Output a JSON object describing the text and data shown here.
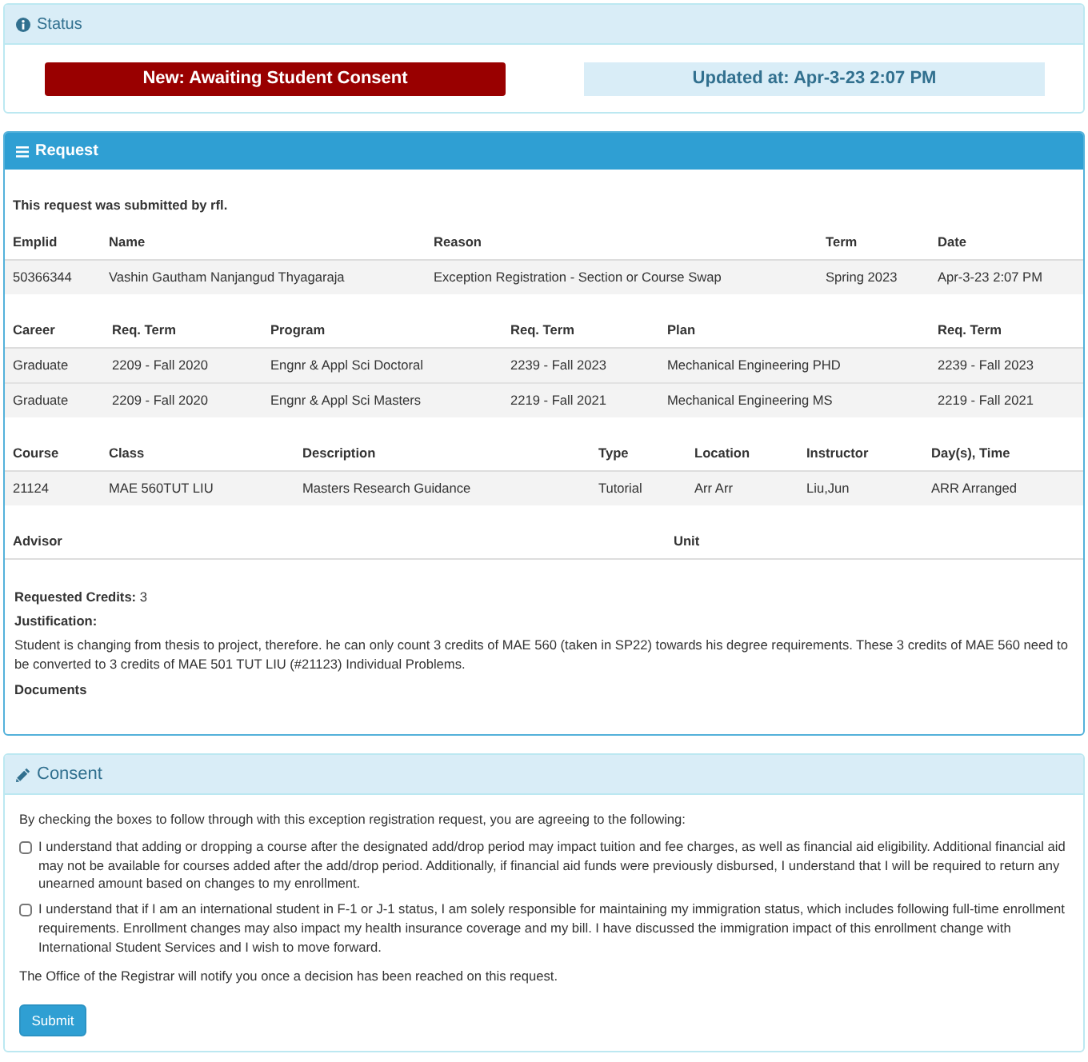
{
  "status": {
    "title": "Status",
    "state": "New: Awaiting Student Consent",
    "updated": "Updated at: Apr-3-23 2:07 PM"
  },
  "request": {
    "title": "Request",
    "submitted_by": "This request was submitted by rfl.",
    "tables": [
      {
        "columns": [
          "Emplid",
          "Name",
          "Reason",
          "Term",
          "Date"
        ],
        "rows": [
          [
            "50366344",
            "Vashin Gautham Nanjangud Thyagaraja",
            "Exception Registration - Section or Course Swap",
            "Spring 2023",
            "Apr-3-23 2:07 PM"
          ]
        ]
      },
      {
        "columns": [
          "Career",
          "Req. Term",
          "Program",
          "Req. Term",
          "Plan",
          "Req. Term"
        ],
        "rows": [
          [
            "Graduate",
            "2209 - Fall 2020",
            "Engnr & Appl Sci Doctoral",
            "2239 - Fall 2023",
            "Mechanical Engineering PHD",
            "2239 - Fall 2023"
          ],
          [
            "Graduate",
            "2209 - Fall 2020",
            "Engnr & Appl Sci Masters",
            "2219 - Fall 2021",
            "Mechanical Engineering MS",
            "2219 - Fall 2021"
          ]
        ]
      },
      {
        "columns": [
          "Course",
          "Class",
          "Description",
          "Type",
          "Location",
          "Instructor",
          "Day(s), Time"
        ],
        "rows": [
          [
            "21124",
            "MAE 560TUT LIU",
            "Masters Research Guidance",
            "Tutorial",
            "Arr Arr",
            "Liu,Jun",
            "ARR Arranged"
          ]
        ]
      },
      {
        "columns": [
          "Advisor",
          "Unit"
        ]
      }
    ],
    "requested_credits": "**Requested Credits:** 3",
    "justification_label": "Justification:",
    "justification": "Student is changing from thesis to project, therefore. he can only count 3 credits of MAE 560 (taken in SP22) towards his degree requirements. These 3 credits of MAE 560 need to be converted to 3 credits of MAE 501 TUT LIU (#21123) Individual Problems.",
    "documents_label": "Documents"
  },
  "consent": {
    "title": "Consent",
    "intro": "By checking the boxes to follow through with this exception registration request, you are agreeing to the following:",
    "items": [
      {
        "text": "I understand that adding or dropping a course after the designated add/drop period may impact tuition and fee charges, as well as financial aid eligibility. Additional financial aid may not be available for courses added after the add/drop period. Additionally, if financial aid funds were previously disbursed, I understand that I will be required to return any unearned amount based on changes to my enrollment.",
        "checked": false
      },
      {
        "text": "I understand that if I am an international student in F-1 or J-1 status, I am solely responsible for maintaining my immigration status, which includes following full-time enrollment requirements. Enrollment changes may also impact my health insurance coverage and my bill. I have discussed the immigration impact of this enrollment change with International Student Services and I wish to move forward.",
        "checked": false
      }
    ],
    "note": "The Office of the Registrar will notify you once a decision has been reached on this request.",
    "submit": "Submit"
  }
}
